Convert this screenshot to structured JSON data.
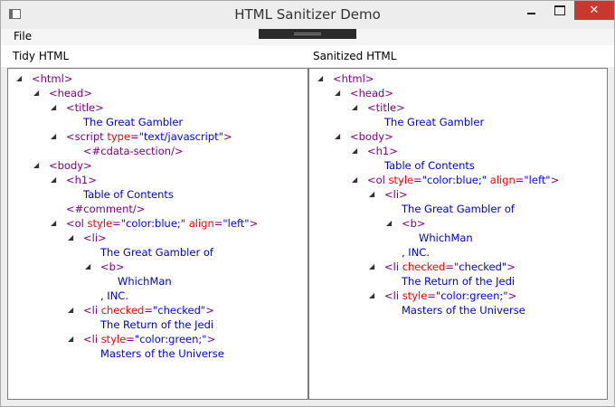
{
  "window": {
    "title": "HTML Sanitizer Demo"
  },
  "menu": {
    "file": "File"
  },
  "labels": {
    "left": "Tidy HTML",
    "right": "Sanitized HTML"
  },
  "icons": {
    "expander": "expanded-triangle-icon",
    "close": "close-icon",
    "minimize": "minimize-icon",
    "maximize": "maximize-icon"
  },
  "left_tree": [
    {
      "depth": 0,
      "expander": true,
      "parts": [
        [
          "tag",
          "<html>"
        ]
      ]
    },
    {
      "depth": 1,
      "expander": true,
      "parts": [
        [
          "tag",
          "<head>"
        ]
      ]
    },
    {
      "depth": 2,
      "expander": true,
      "parts": [
        [
          "tag",
          "<title>"
        ]
      ]
    },
    {
      "depth": 3,
      "expander": false,
      "parts": [
        [
          "txt",
          "The Great Gambler"
        ]
      ]
    },
    {
      "depth": 2,
      "expander": true,
      "parts": [
        [
          "tag",
          "<script "
        ],
        [
          "attr",
          "type"
        ],
        [
          "tag",
          "="
        ],
        [
          "val",
          "\"text/javascript\""
        ],
        [
          "tag",
          ">"
        ]
      ]
    },
    {
      "depth": 3,
      "expander": false,
      "parts": [
        [
          "tag",
          "<#cdata-section/>"
        ]
      ]
    },
    {
      "depth": 1,
      "expander": true,
      "parts": [
        [
          "tag",
          "<body>"
        ]
      ]
    },
    {
      "depth": 2,
      "expander": true,
      "parts": [
        [
          "tag",
          "<h1>"
        ]
      ]
    },
    {
      "depth": 3,
      "expander": false,
      "parts": [
        [
          "txt",
          "Table of Contents"
        ]
      ]
    },
    {
      "depth": 2,
      "expander": false,
      "parts": [
        [
          "tag",
          "<#comment/>"
        ]
      ]
    },
    {
      "depth": 2,
      "expander": true,
      "parts": [
        [
          "tag",
          "<ol "
        ],
        [
          "attr",
          "style"
        ],
        [
          "tag",
          "="
        ],
        [
          "val",
          "\"color:blue;\""
        ],
        [
          "tag",
          " "
        ],
        [
          "attr",
          "align"
        ],
        [
          "tag",
          "="
        ],
        [
          "val",
          "\"left\""
        ],
        [
          "tag",
          ">"
        ]
      ]
    },
    {
      "depth": 3,
      "expander": true,
      "parts": [
        [
          "tag",
          "<li>"
        ]
      ]
    },
    {
      "depth": 4,
      "expander": false,
      "parts": [
        [
          "txt",
          "The Great Gambler of"
        ]
      ]
    },
    {
      "depth": 4,
      "expander": true,
      "parts": [
        [
          "tag",
          "<b>"
        ]
      ]
    },
    {
      "depth": 5,
      "expander": false,
      "parts": [
        [
          "txt",
          "WhichMan"
        ]
      ]
    },
    {
      "depth": 4,
      "expander": false,
      "parts": [
        [
          "txt",
          ", INC."
        ]
      ]
    },
    {
      "depth": 3,
      "expander": true,
      "parts": [
        [
          "tag",
          "<li "
        ],
        [
          "attr",
          "checked"
        ],
        [
          "tag",
          "="
        ],
        [
          "val",
          "\"checked\""
        ],
        [
          "tag",
          ">"
        ]
      ]
    },
    {
      "depth": 4,
      "expander": false,
      "parts": [
        [
          "txt",
          "The Return of the Jedi"
        ]
      ]
    },
    {
      "depth": 3,
      "expander": true,
      "parts": [
        [
          "tag",
          "<li "
        ],
        [
          "attr",
          "style"
        ],
        [
          "tag",
          "="
        ],
        [
          "val",
          "\"color:green;\""
        ],
        [
          "tag",
          ">"
        ]
      ]
    },
    {
      "depth": 4,
      "expander": false,
      "parts": [
        [
          "txt",
          "Masters of the Universe"
        ]
      ]
    }
  ],
  "right_tree": [
    {
      "depth": 0,
      "expander": true,
      "parts": [
        [
          "tag",
          "<html>"
        ]
      ]
    },
    {
      "depth": 1,
      "expander": true,
      "parts": [
        [
          "tag",
          "<head>"
        ]
      ]
    },
    {
      "depth": 2,
      "expander": true,
      "parts": [
        [
          "tag",
          "<title>"
        ]
      ]
    },
    {
      "depth": 3,
      "expander": false,
      "parts": [
        [
          "txt",
          "The Great Gambler"
        ]
      ]
    },
    {
      "depth": 1,
      "expander": true,
      "parts": [
        [
          "tag",
          "<body>"
        ]
      ]
    },
    {
      "depth": 2,
      "expander": true,
      "parts": [
        [
          "tag",
          "<h1>"
        ]
      ]
    },
    {
      "depth": 3,
      "expander": false,
      "parts": [
        [
          "txt",
          "Table of Contents"
        ]
      ]
    },
    {
      "depth": 2,
      "expander": true,
      "parts": [
        [
          "tag",
          "<ol "
        ],
        [
          "attr",
          "style"
        ],
        [
          "tag",
          "="
        ],
        [
          "val",
          "\"color:blue;\""
        ],
        [
          "tag",
          " "
        ],
        [
          "attr",
          "align"
        ],
        [
          "tag",
          "="
        ],
        [
          "val",
          "\"left\""
        ],
        [
          "tag",
          ">"
        ]
      ]
    },
    {
      "depth": 3,
      "expander": true,
      "parts": [
        [
          "tag",
          "<li>"
        ]
      ]
    },
    {
      "depth": 4,
      "expander": false,
      "parts": [
        [
          "txt",
          "The Great Gambler of"
        ]
      ]
    },
    {
      "depth": 4,
      "expander": true,
      "parts": [
        [
          "tag",
          "<b>"
        ]
      ]
    },
    {
      "depth": 5,
      "expander": false,
      "parts": [
        [
          "txt",
          "WhichMan"
        ]
      ]
    },
    {
      "depth": 4,
      "expander": false,
      "parts": [
        [
          "txt",
          ", INC."
        ]
      ]
    },
    {
      "depth": 3,
      "expander": true,
      "parts": [
        [
          "tag",
          "<li "
        ],
        [
          "attr",
          "checked"
        ],
        [
          "tag",
          "="
        ],
        [
          "val",
          "\"checked\""
        ],
        [
          "tag",
          ">"
        ]
      ]
    },
    {
      "depth": 4,
      "expander": false,
      "parts": [
        [
          "txt",
          "The Return of the Jedi"
        ]
      ]
    },
    {
      "depth": 3,
      "expander": true,
      "parts": [
        [
          "tag",
          "<li "
        ],
        [
          "attr",
          "style"
        ],
        [
          "tag",
          "="
        ],
        [
          "val",
          "\"color:green;\""
        ],
        [
          "tag",
          ">"
        ]
      ]
    },
    {
      "depth": 4,
      "expander": false,
      "parts": [
        [
          "txt",
          "Masters of the Universe"
        ]
      ]
    }
  ]
}
